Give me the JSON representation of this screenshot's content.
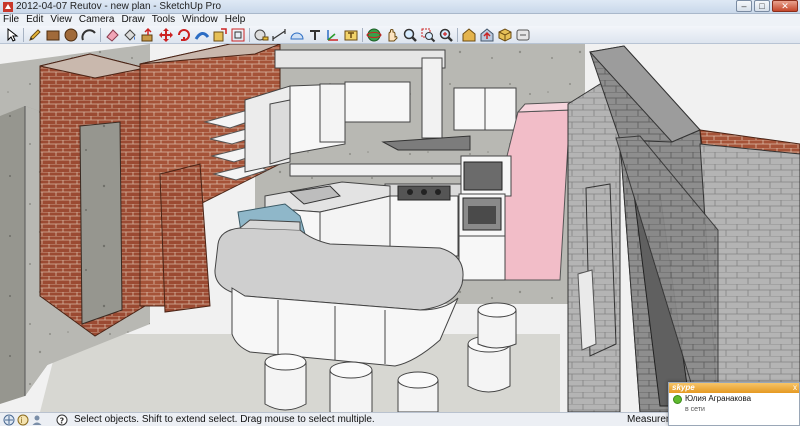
{
  "window": {
    "title": "2012-04-07 Reutov - new plan - SketchUp Pro",
    "minimize": "–",
    "maximize": "□",
    "close": "✕"
  },
  "menu": [
    "File",
    "Edit",
    "View",
    "Camera",
    "Draw",
    "Tools",
    "Window",
    "Help"
  ],
  "toolbar": {
    "tools": [
      "select-tool-icon",
      "pencil-tool-icon",
      "rectangle-tool-icon",
      "circle-tool-icon",
      "arc-tool-icon",
      "eraser-tool-icon",
      "paint-bucket-icon",
      "push-pull-icon",
      "move-tool-icon",
      "rotate-tool-icon",
      "follow-me-icon",
      "scale-tool-icon",
      "offset-tool-icon",
      "tape-measure-icon",
      "dimension-icon",
      "protractor-icon",
      "text-tool-icon",
      "axes-tool-icon",
      "3d-text-icon",
      "orbit-tool-icon",
      "pan-tool-icon",
      "zoom-tool-icon",
      "zoom-window-icon",
      "zoom-extents-icon",
      "warehouse-icon",
      "share-model-icon",
      "components-icon",
      "extension-icon"
    ]
  },
  "status": {
    "hint": "Select objects. Shift to extend select. Drag mouse to select multiple.",
    "measurements_label": "Measureme"
  },
  "skype": {
    "brand": "skype",
    "close": "x",
    "contact_name": "Юлия Агранакова",
    "contact_status": "в сети"
  },
  "colors": {
    "brick": "#9b4a32",
    "concrete": "#b9b9b5",
    "pink_fridge": "#f2bdc8",
    "cabinet_white": "#f7f7f7",
    "cmu_block": "#8f8f8f",
    "skype_orange": "#e8a234"
  }
}
